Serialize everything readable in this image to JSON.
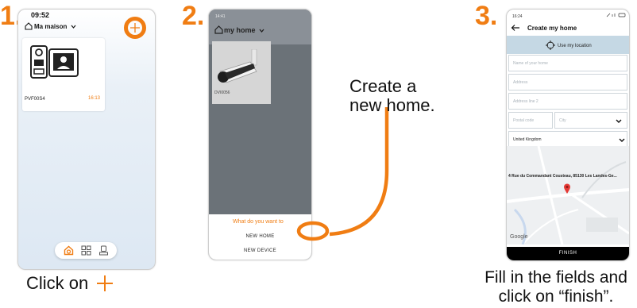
{
  "steps": [
    {
      "number": "1.",
      "caption": "Click on"
    },
    {
      "number": "2.",
      "caption_lines": [
        "Create a",
        "new home."
      ]
    },
    {
      "number": "3.",
      "caption_lines": [
        "Fill in the fields and",
        "click on “finish”."
      ]
    }
  ],
  "phone1": {
    "time": "09:52",
    "home_name": "Ma maison",
    "device_name": "PVF00S4",
    "device_time": "16:13",
    "icons": [
      "home-icon",
      "chevron-down-icon",
      "plus-icon",
      "intercom-icon",
      "tab-home-icon",
      "tab-grid-icon",
      "tab-device-icon"
    ]
  },
  "phone2": {
    "time": "14:41",
    "home_name": "my home",
    "device_name": "DVI0056",
    "sheet_question": "What do you want to",
    "option_new_home": "NEW HOME",
    "option_new_device": "NEW DEVICE"
  },
  "phone3": {
    "time": "16:24",
    "title": "Create my home",
    "use_location": "Use my location",
    "placeholders": {
      "home_name": "Name of your home",
      "address": "Address",
      "address2": "Address line 2",
      "postal": "Postal code",
      "city": "City"
    },
    "country": "United Kingdom",
    "map_address": "4 Rue du Commandant Cousteau, 85130 Les Landes-Ge...",
    "map_provider": "Google",
    "finish_label": "FINISH"
  },
  "colors": {
    "accent": "#f07d13",
    "map_bar": "#c5d8e4"
  }
}
